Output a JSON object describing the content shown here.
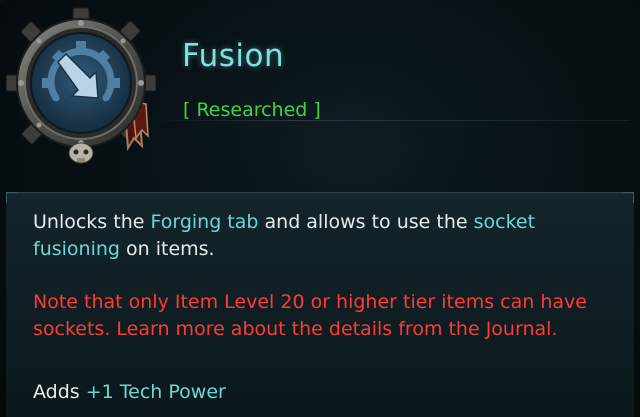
{
  "tooltip": {
    "title": "Fusion",
    "status": "[ Researched ]",
    "description": {
      "part1": "Unlocks the ",
      "link1": "Forging tab",
      "part2": " and allows to use the ",
      "link2": "socket fusioning",
      "part3": " on items."
    },
    "note": "Note that only Item Level 20 or higher tier items can have sockets. Learn more about the details from the Journal.",
    "adds": {
      "prefix": "Adds ",
      "value": "+1 Tech Power"
    },
    "badge_icon": "gear-arrow-icon"
  },
  "colors": {
    "title": "#7fe2de",
    "status": "#3fd24e",
    "highlight": "#6fd6d6",
    "warning": "#ff3b34",
    "body_text": "#e6ecec"
  }
}
